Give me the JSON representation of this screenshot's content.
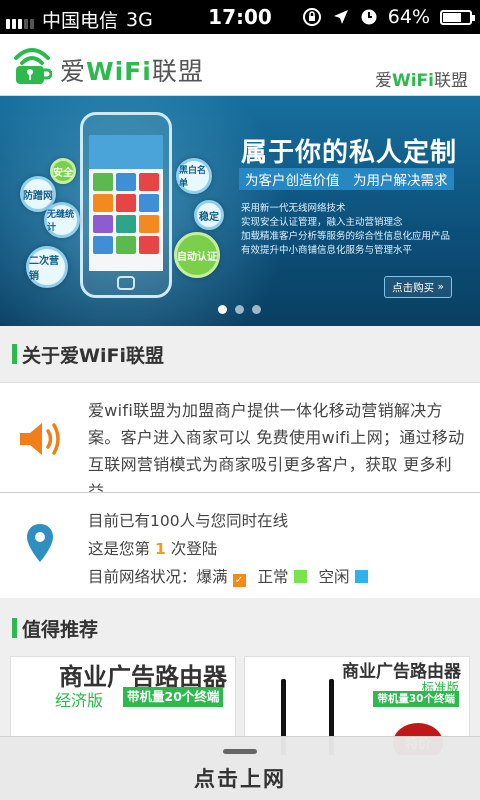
{
  "status_bar": {
    "carrier": "中国电信",
    "network": "3G",
    "time": "17:00",
    "battery": "64%"
  },
  "header": {
    "brand_prefix": "爱",
    "brand_wifi": "WiFi",
    "brand_suffix": "联盟",
    "icon": "wifi-cup-logo"
  },
  "banner": {
    "title": "属于你的私人定制",
    "subtitle": "为客户创造价值　为用户解决需求",
    "lines": [
      "采用新一代无线网络技术",
      "实现安全认证管理，融入主动营销理念",
      "加载精准客户分析等服务的综合性信息化应用产品",
      "有效提升中小商铺信息化服务与管理水平"
    ],
    "bubbles": [
      "安全",
      "防蹭网",
      "无缝统计",
      "二次营销",
      "黑白名单",
      "稳定",
      "自动认证"
    ],
    "buy_button": "点击购买",
    "slides": 3,
    "active_slide": 0
  },
  "about": {
    "title": "关于爱WiFi联盟",
    "description": "爱wifi联盟为加盟商户提供一体化移动营销解决方案。客户进入商家可以 免费使用wifi上网；通过移动互联网营销模式为商家吸引更多客户，获取 更多利益。",
    "icon": "speaker-icon"
  },
  "status": {
    "online_text": "目前已有100人与您同时在线",
    "login_prefix": "这是您第",
    "login_count": "1",
    "login_suffix": "次登陆",
    "network_label": "目前网络状况：",
    "legend": [
      {
        "label": "爆满",
        "color": "#f08a1a"
      },
      {
        "label": "正常",
        "color": "#79e34c"
      },
      {
        "label": "空闲",
        "color": "#2fb2ec"
      }
    ],
    "icon": "location-pin-icon"
  },
  "recommend": {
    "title": "值得推荐",
    "products": [
      {
        "name": "商业广告路由器",
        "edition": "经济版",
        "tag": "带机量20个终端"
      },
      {
        "name": "商业广告路由器",
        "edition": "标准版",
        "tag": "带机量30个终端",
        "promo": "特价"
      }
    ]
  },
  "bottom": {
    "button": "点击上网"
  }
}
